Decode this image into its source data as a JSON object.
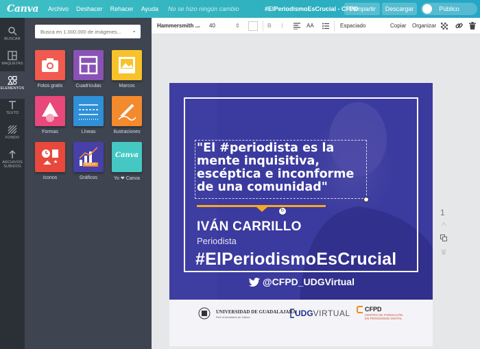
{
  "topbar": {
    "logo": "Canva",
    "menu": [
      "Archivo",
      "Deshacer",
      "Rehacer",
      "Ayuda"
    ],
    "status": "No se hizo ningún cambio",
    "doc_title": "#ElPeriodismoEsCrucial - CFPD",
    "share_label": "Compartir",
    "download_label": "Descargar",
    "visibility_label": "Público"
  },
  "rail": {
    "items": [
      {
        "label": "BUSCAR",
        "icon": "search-icon"
      },
      {
        "label": "MAQUETAS",
        "icon": "layouts-icon"
      },
      {
        "label": "ELEMENTOS",
        "icon": "elements-icon"
      },
      {
        "label": "TEXTO",
        "icon": "text-icon"
      },
      {
        "label": "FONDO",
        "icon": "background-icon"
      },
      {
        "label": "ARCHIVOS SUBIDOS",
        "icon": "upload-icon"
      }
    ]
  },
  "panel": {
    "search_placeholder": "Busca en 1.000.000 de imágenes...",
    "tiles": [
      {
        "label": "Fotos gratis",
        "color": "#f05a4f",
        "icon": "camera-icon"
      },
      {
        "label": "Cuadrículas",
        "color": "#8a52b4",
        "icon": "grid-icon"
      },
      {
        "label": "Marcos",
        "color": "#f8c22b",
        "icon": "frame-icon"
      },
      {
        "label": "Formas",
        "color": "#e8487a",
        "icon": "shapes-icon"
      },
      {
        "label": "Líneas",
        "color": "#2f90d8",
        "icon": "lines-icon"
      },
      {
        "label": "Ilustraciones",
        "color": "#f38a2e",
        "icon": "pencil-icon"
      },
      {
        "label": "Iconos",
        "color": "#e9483c",
        "icon": "icons-icon"
      },
      {
        "label": "Gráficos",
        "color": "#4740a8",
        "icon": "chart-icon",
        "badge": "NUEVO"
      },
      {
        "label": "Yo ❤ Canva",
        "color": "#45c8c4",
        "icon": "canva-icon",
        "tile_text": "Canva"
      }
    ]
  },
  "toolbar": {
    "font": "Hammersmith ...",
    "size": "40",
    "bold": "B",
    "italic": "I",
    "case": "AA",
    "spacing_label": "Espaciado",
    "copy_label": "Copiar",
    "arrange_label": "Organizar"
  },
  "design": {
    "quote": "\"El #periodista es la mente inquisitiva, escéptica e inconforme de una comunidad\"",
    "name": "IVÁN CARRILLO",
    "role": "Periodista",
    "hashtag": "#ElPeriodismoEsCrucial",
    "twitter": "@CFPD_UDGVirtual",
    "colors": {
      "overlay": "#3b3a9e",
      "accent": "#f7a823",
      "footer": "#f4f4f8"
    },
    "footer": {
      "udg_name": "UNIVERSIDAD DE GUADALAJARA",
      "udg_sub": "Red Universitaria de Jalisco",
      "udgv_a": "UDG",
      "udgv_b": "VIRTUAL",
      "cfpd": "CFPD",
      "cfpd_sub_1": "CENTRO DE FORMACIÓN",
      "cfpd_sub_2": "EN PERIODISMO DIGITAL"
    }
  },
  "page": {
    "number": "1"
  }
}
